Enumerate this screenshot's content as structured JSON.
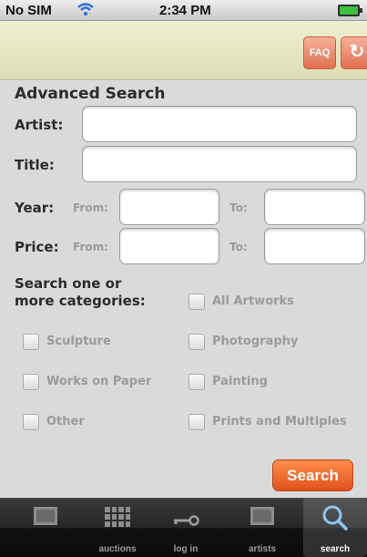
{
  "status_bar": {
    "carrier": "No SIM",
    "time": "2:34 PM"
  },
  "nav": {
    "faq": "FAQ",
    "refresh_glyph": "↻",
    "accent": "#e06f4f"
  },
  "form": {
    "heading": "Advanced Search",
    "artist_label": "Artist:",
    "artist_value": "",
    "title_label": "Title:",
    "title_value": "",
    "year_label": "Year:",
    "price_label": "Price:",
    "from_label": "From:",
    "to_label": "To:",
    "categories_heading_line1": "Search one or",
    "categories_heading_line2": "more categories:",
    "categories": [
      "All Artworks",
      "Sculpture",
      "Photography",
      "Works on Paper",
      "Painting",
      "Other",
      "Prints and Multiples"
    ],
    "search_button": "Search",
    "search_button_color": "#e0511c"
  },
  "tabbar": {
    "tabs": [
      {
        "label": "",
        "icon": "frame-icon"
      },
      {
        "label": "auctions",
        "icon": "grid-icon"
      },
      {
        "label": "log in",
        "icon": "key-icon"
      },
      {
        "label": "artists",
        "icon": "frame-icon"
      },
      {
        "label": "search",
        "icon": "magnifier-icon",
        "active": true
      }
    ]
  }
}
